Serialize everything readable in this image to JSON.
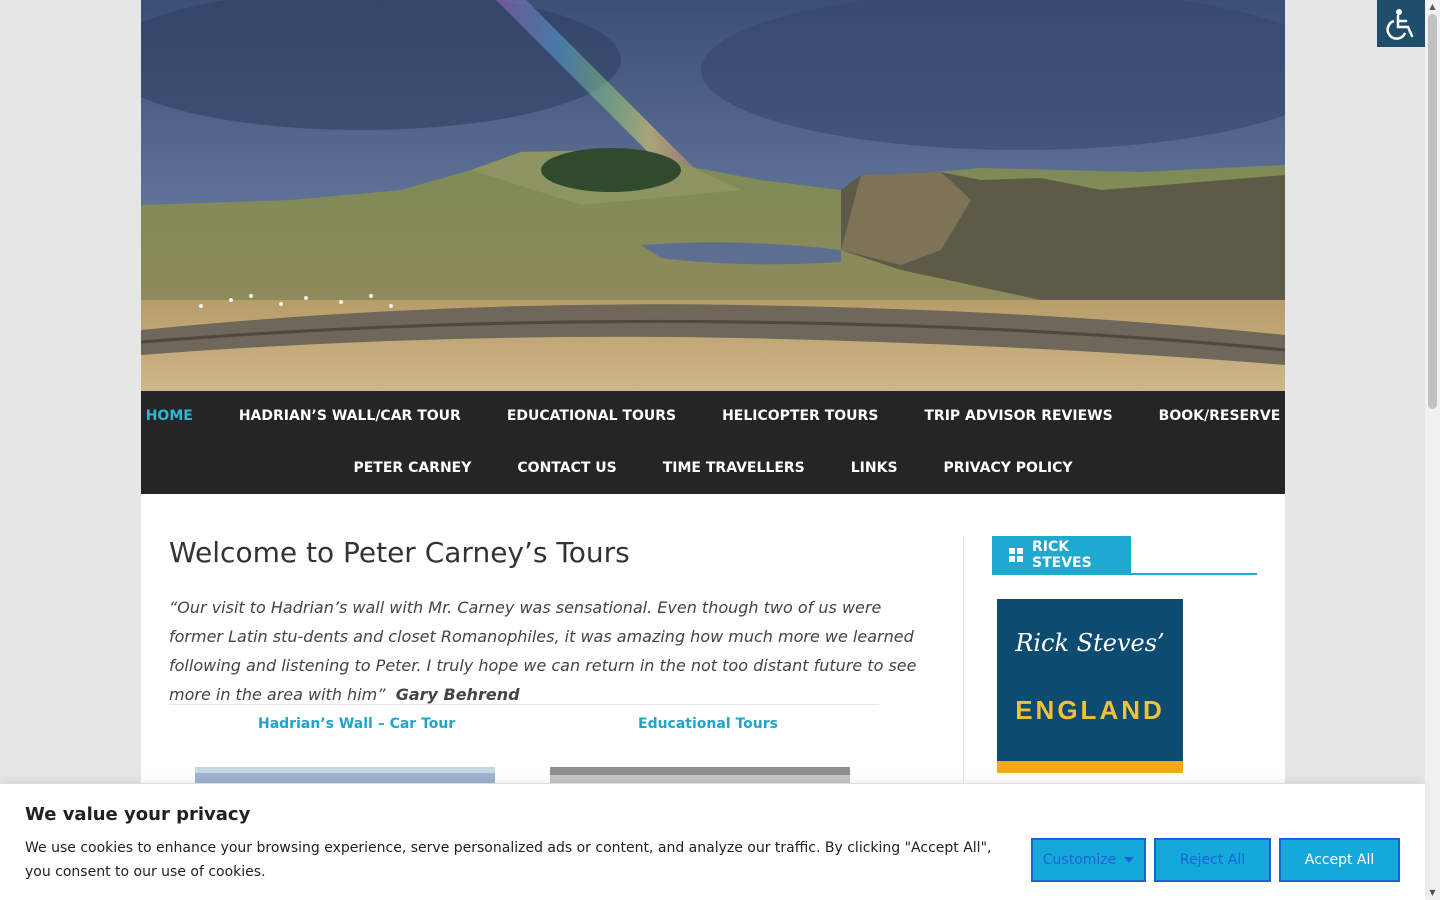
{
  "nav": {
    "row1": [
      "HOME",
      "HADRIAN’S WALL/CAR TOUR",
      "EDUCATIONAL TOURS",
      "HELICOPTER TOURS",
      "TRIP ADVISOR REVIEWS",
      "BOOK/RESERVE"
    ],
    "row2": [
      "PETER CARNEY",
      "CONTACT US",
      "TIME TRAVELLERS",
      "LINKS",
      "PRIVACY POLICY"
    ],
    "active": "HOME"
  },
  "main": {
    "title": "Welcome to Peter Carney’s Tours",
    "quote": "“Our visit to Hadrian’s wall with Mr. Carney was sensational. Even though two of us were former Latin stu-dents and closet Romanophiles, it was amazing how much more we learned following and listening to Peter. I truly hope we can return in the not too distant future to see more in the area with him”",
    "quote_author": "Gary Behrend",
    "columns": [
      "Hadrian’s Wall – Car Tour",
      "Educational Tours"
    ]
  },
  "sidebar": {
    "widget_title": "RICK STEVES",
    "book_brand": "Rick Steves’",
    "book_title": "ENGLAND"
  },
  "cookie": {
    "title": "We value your privacy",
    "text": "We use cookies to enhance your browsing experience, serve personalized ads or content, and analyze our traffic. By clicking \"Accept All\", you consent to our use of cookies.",
    "customize": "Customize",
    "reject": "Reject All",
    "accept": "Accept All"
  },
  "colors": {
    "accent": "#1fa9d1",
    "nav_bg": "#252525",
    "button_border": "#1863dc"
  }
}
